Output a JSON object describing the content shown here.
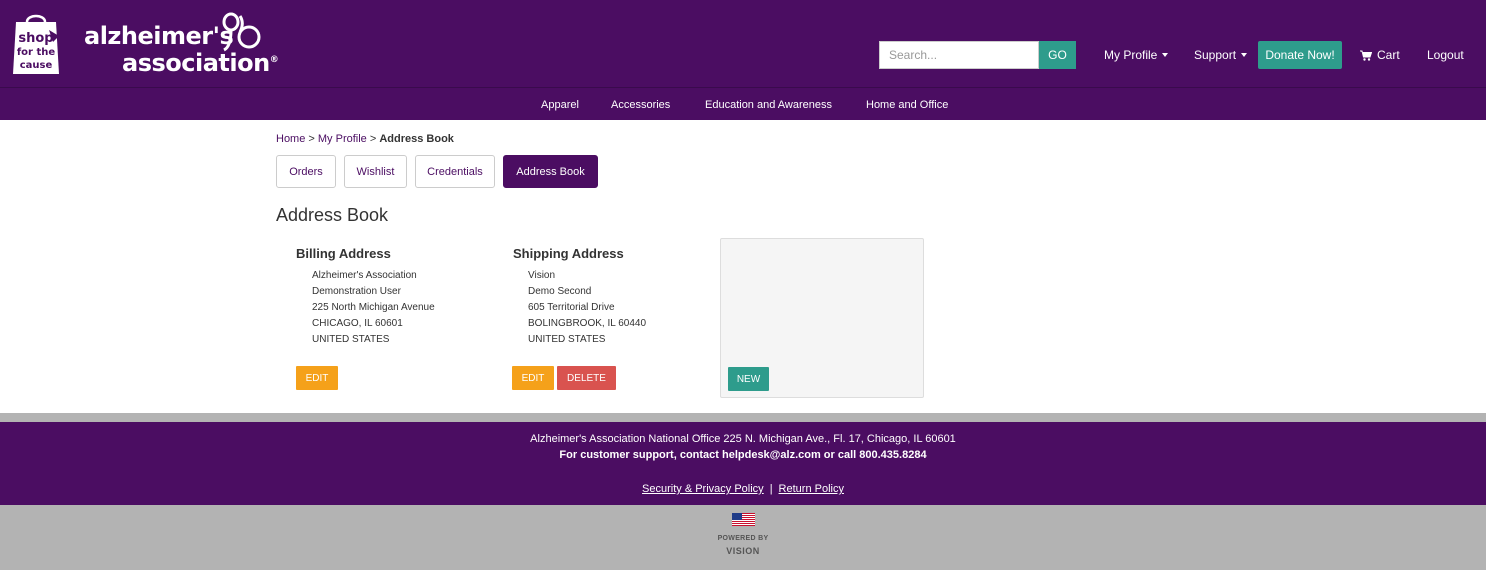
{
  "brand": {
    "badge_lines": [
      "shop",
      "for the",
      "cause"
    ],
    "name_line1": "alzheimer's",
    "name_line2": "association",
    "registered": "®"
  },
  "header": {
    "search_placeholder": "Search...",
    "go_label": "GO",
    "my_profile": "My Profile",
    "support": "Support",
    "donate": "Donate Now!",
    "cart": "Cart",
    "logout": "Logout"
  },
  "nav": {
    "items": [
      "Apparel",
      "Accessories",
      "Education and Awareness",
      "Home and Office"
    ]
  },
  "breadcrumb": {
    "home": "Home",
    "sep1": " > ",
    "profile": "My Profile",
    "sep2": " > ",
    "current": "Address Book"
  },
  "tabs": [
    "Orders",
    "Wishlist",
    "Credentials",
    "Address Book"
  ],
  "page_title": "Address Book",
  "billing": {
    "title": "Billing Address",
    "lines": [
      "Alzheimer's Association",
      "Demonstration User",
      "225 North Michigan Avenue",
      "CHICAGO, IL 60601",
      "UNITED STATES"
    ],
    "edit": "EDIT"
  },
  "shipping": {
    "title": "Shipping Address",
    "lines": [
      "Vision",
      "Demo Second",
      "605 Territorial Drive",
      "BOLINGBROOK, IL 60440",
      "UNITED STATES"
    ],
    "edit": "EDIT",
    "delete": "DELETE"
  },
  "new_label": "NEW",
  "footer": {
    "office": "Alzheimer's Association National Office 225 N. Michigan Ave., Fl. 17, Chicago, IL 60601",
    "support": "For customer support, contact helpdesk@alz.com or call 800.435.8284",
    "privacy": "Security & Privacy Policy",
    "separator": "|",
    "return": "Return Policy",
    "powered_by": "POWERED BY",
    "vision": "VISION"
  },
  "colors": {
    "brand_purple": "#4b0d62",
    "teal": "#2e9c8c",
    "edit_orange": "#f5a11a",
    "delete_red": "#d9534f",
    "footer_grey": "#b3b3b3"
  }
}
